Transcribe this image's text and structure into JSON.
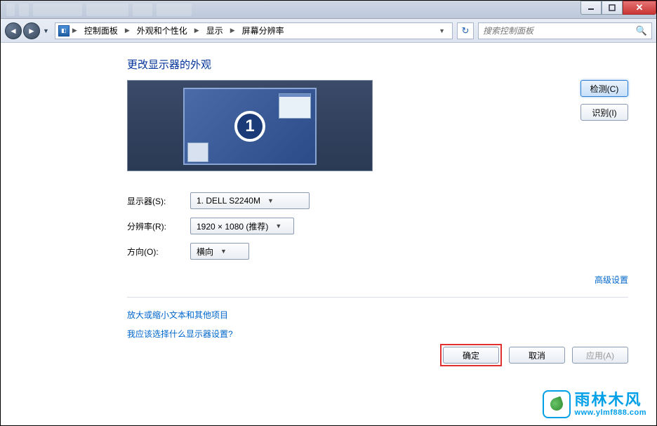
{
  "breadcrumb": {
    "root": "控制面板",
    "cat": "外观和个性化",
    "sub": "显示",
    "page": "屏幕分辨率"
  },
  "search": {
    "placeholder": "搜索控制面板"
  },
  "title": "更改显示器的外观",
  "monitor_number": "1",
  "buttons": {
    "detect": "检测(C)",
    "identify": "识别(I)",
    "ok": "确定",
    "cancel": "取消",
    "apply": "应用(A)"
  },
  "labels": {
    "display": "显示器(S):",
    "resolution": "分辨率(R):",
    "orientation": "方向(O):"
  },
  "values": {
    "display": "1. DELL S2240M",
    "resolution": "1920 × 1080 (推荐)",
    "orientation": "横向"
  },
  "links": {
    "advanced": "高级设置",
    "text_size": "放大或缩小文本和其他项目",
    "help": "我应该选择什么显示器设置?"
  },
  "watermark": {
    "cn": "雨林木风",
    "url": "www.ylmf888.com"
  }
}
